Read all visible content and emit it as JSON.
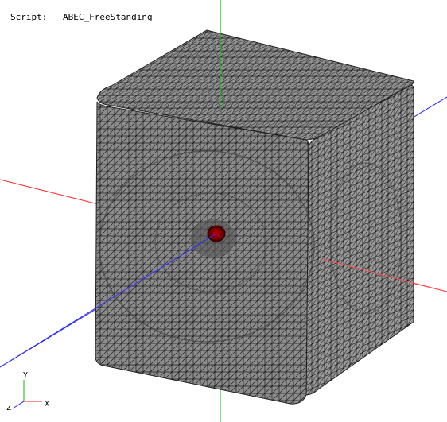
{
  "header": {
    "script_label": "Script:",
    "script_name": "ABEC_FreeStanding"
  },
  "triad": {
    "x_label": "X",
    "y_label": "Y",
    "z_label": "Z"
  },
  "colors": {
    "x_axis": "#ff2020",
    "y_axis": "#00c000",
    "z_axis": "#2020ff",
    "mesh_face": "#8a8a8a",
    "mesh_line": "#1e1e1e",
    "driver": "#8b0000"
  },
  "icons": {
    "model": "meshed-cabinet",
    "triad": "coordinate-triad-icon"
  }
}
